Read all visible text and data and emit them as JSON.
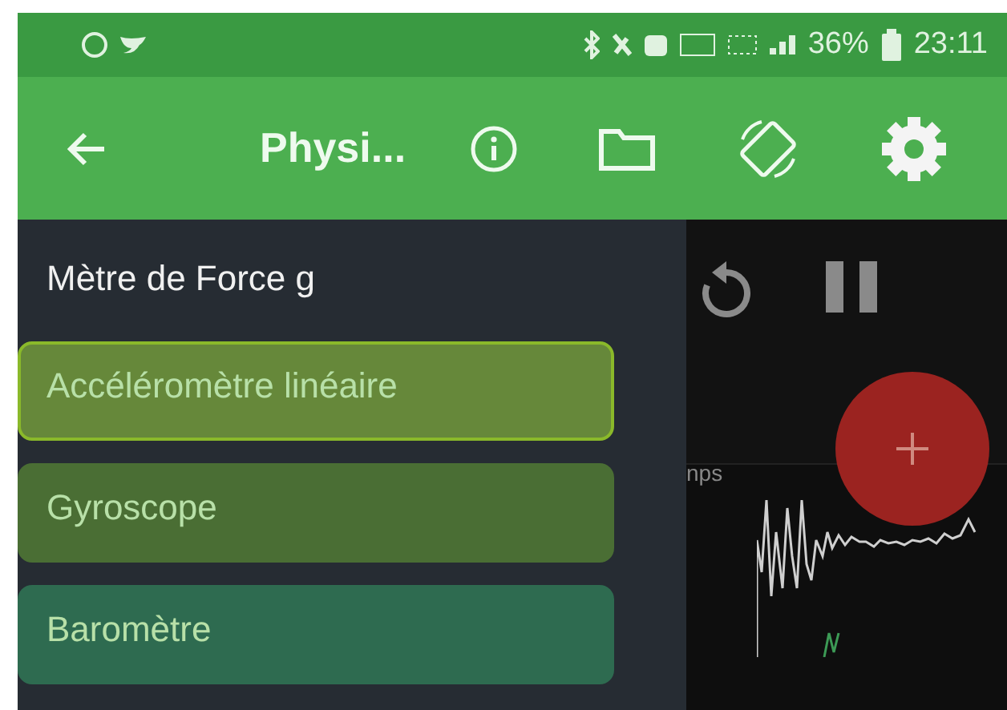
{
  "status_bar": {
    "battery": "36%",
    "time": "23:11"
  },
  "app_bar": {
    "title": "Physi..."
  },
  "drawer": {
    "title": "Mètre de Force g",
    "items": [
      {
        "label": "Accéléromètre linéaire",
        "color": "#66883a",
        "selected": true
      },
      {
        "label": "Gyroscope",
        "color": "#4a6e34",
        "selected": false
      },
      {
        "label": "Baromètre",
        "color": "#2e6b50",
        "selected": false
      }
    ]
  },
  "graph": {
    "axis_label": "nps"
  }
}
